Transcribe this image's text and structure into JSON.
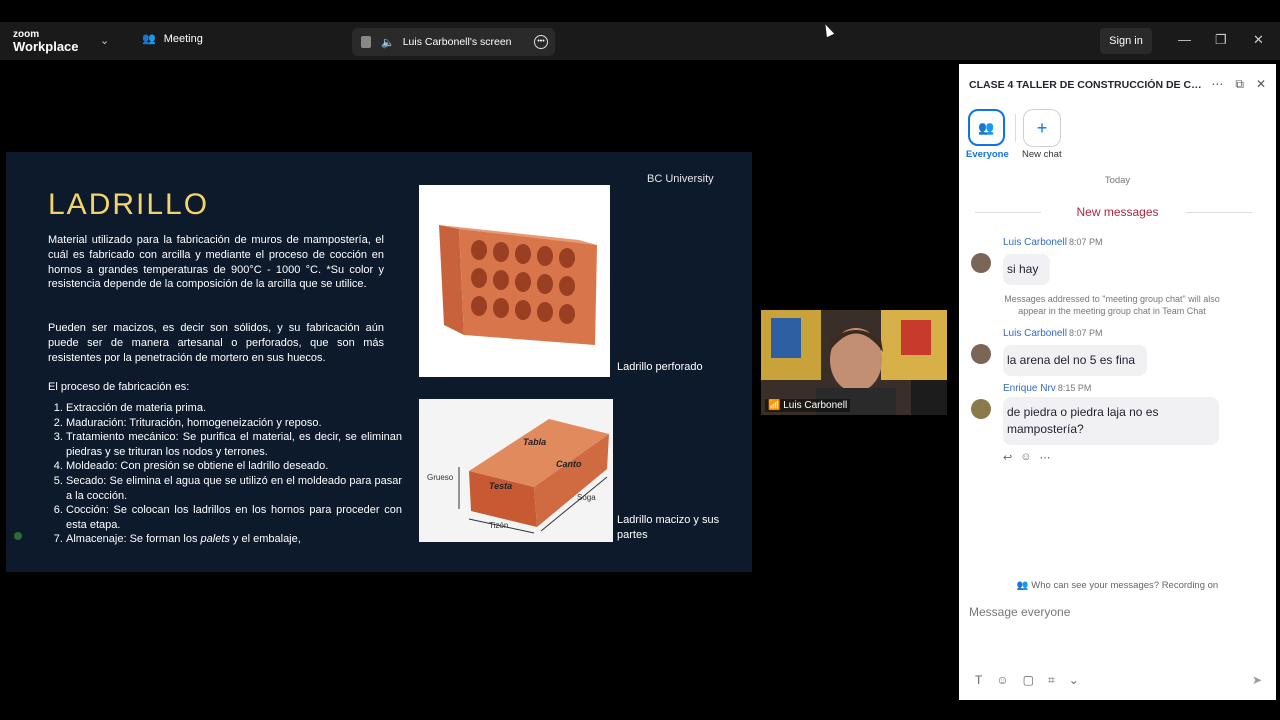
{
  "topbar": {
    "logo_small": "zoom",
    "logo_big": "Workplace",
    "meeting_label": "Meeting",
    "share_label": "Luis Carbonell's screen",
    "signin_label": "Sign in"
  },
  "slide": {
    "title": "LADRILLO",
    "org": "BC University",
    "para1": "Material utilizado para la fabricación de muros de mampostería, el cuál es fabricado con arcilla y mediante el proceso de cocción en hornos a grandes temperaturas de 900°C - 1000 °C. *Su color y resistencia depende de la composición de la arcilla que se utilice.",
    "para2": "Pueden ser macizos, es decir son sólidos, y su fabricación aún puede ser de manera artesanal o perforados, que son más resistentes por la penetración de mortero en sus huecos.",
    "process_intro": "El proceso de fabricación es:",
    "steps": [
      "Extracción de materia prima.",
      "Maduración: Trituración, homogeneización y reposo.",
      "Tratamiento mecánico: Se purifica el material, es decir, se eliminan piedras y se trituran los nodos y terrones.",
      "Moldeado: Con presión se obtiene el ladrillo deseado.",
      "Secado: Se elimina el agua que se utilizó en el moldeado para pasar a la cocción.",
      "Cocción: Se colocan los ladrillos en los hornos para proceder con esta etapa."
    ],
    "step7_pre": "Almacenaje: Se forman los ",
    "step7_em": "palets",
    "step7_post": " y el embalaje,",
    "caption1": "Ladrillo perforado",
    "caption2": "Ladrillo macizo y sus partes",
    "diagram_labels": {
      "tabla": "Tabla",
      "canto": "Canto",
      "testa": "Testa",
      "grueso": "Grueso",
      "soga": "Soga",
      "tizon": "Tizón"
    }
  },
  "video": {
    "name": "Luis Carbonell"
  },
  "chat": {
    "title": "CLASE 4 TALLER DE  CONSTRUCCIÓN DE CAS...",
    "everyone_label": "Everyone",
    "newchat_label": "New chat",
    "today": "Today",
    "new_messages": "New messages",
    "messages": [
      {
        "sender": "Luis Carbonell",
        "time": "8:07 PM",
        "text": "si hay"
      },
      {
        "sender": "Luis Carbonell",
        "time": "8:07 PM",
        "text": "la arena del no 5 es fina"
      },
      {
        "sender": "Enrique Nrv",
        "time": "8:15 PM",
        "text": "de piedra o piedra laja no es mampostería?"
      }
    ],
    "note": "Messages addressed to \"meeting group chat\" will also appear in the meeting group chat in Team Chat",
    "who_can_see": "Who can see your messages? Recording on",
    "composer_placeholder": "Message everyone"
  }
}
